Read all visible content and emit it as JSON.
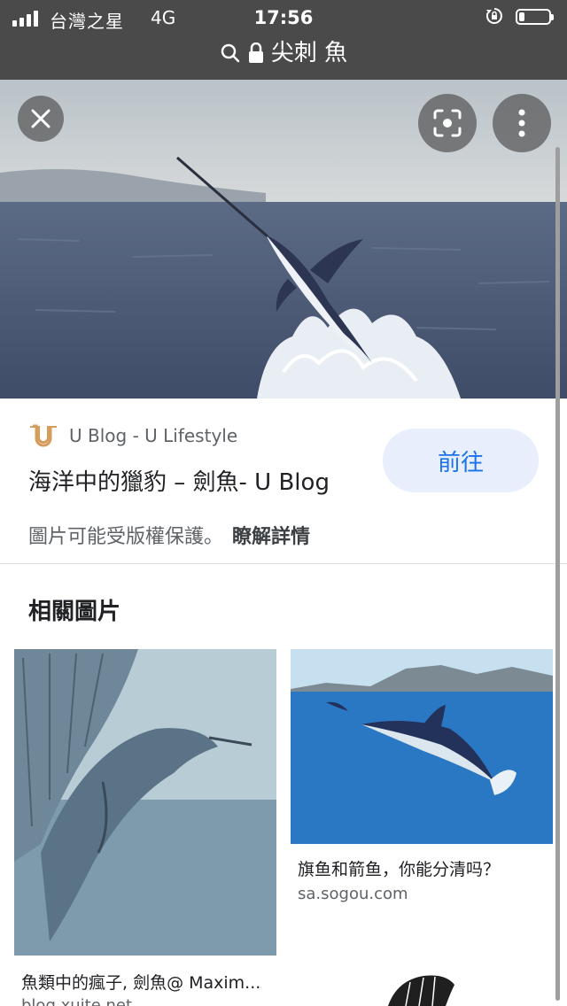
{
  "status_bar": {
    "carrier": "台灣之星",
    "network": "4G",
    "time": "17:56",
    "battery_level": 0.2
  },
  "url_bar": {
    "query": "尖刺 魚",
    "search_icon": "search-icon",
    "lock_icon": "lock-icon"
  },
  "viewer": {
    "close_icon": "close-icon",
    "lens_icon": "google-lens-icon",
    "more_icon": "more-vertical-icon"
  },
  "result": {
    "source_name": "U Blog - U Lifestyle",
    "title": "海洋中的獵豹 – 劍魚- U Blog",
    "visit_label": "前往",
    "copyright_notice": "圖片可能受版權保護。",
    "learn_more": "瞭解詳情"
  },
  "related": {
    "heading": "相關圖片",
    "items": [
      {
        "caption": "魚類中的瘋子, 劍魚@ Maxim...",
        "source": "blog.xuite.net"
      },
      {
        "caption": "旗鱼和箭鱼，你能分清吗？",
        "source": "sa.sogou.com"
      },
      {
        "caption": "",
        "source": ""
      }
    ]
  },
  "colors": {
    "accent": "#1a73e8",
    "visit_button_bg": "#e8eefc",
    "top_bar": "#4a4a4a"
  }
}
